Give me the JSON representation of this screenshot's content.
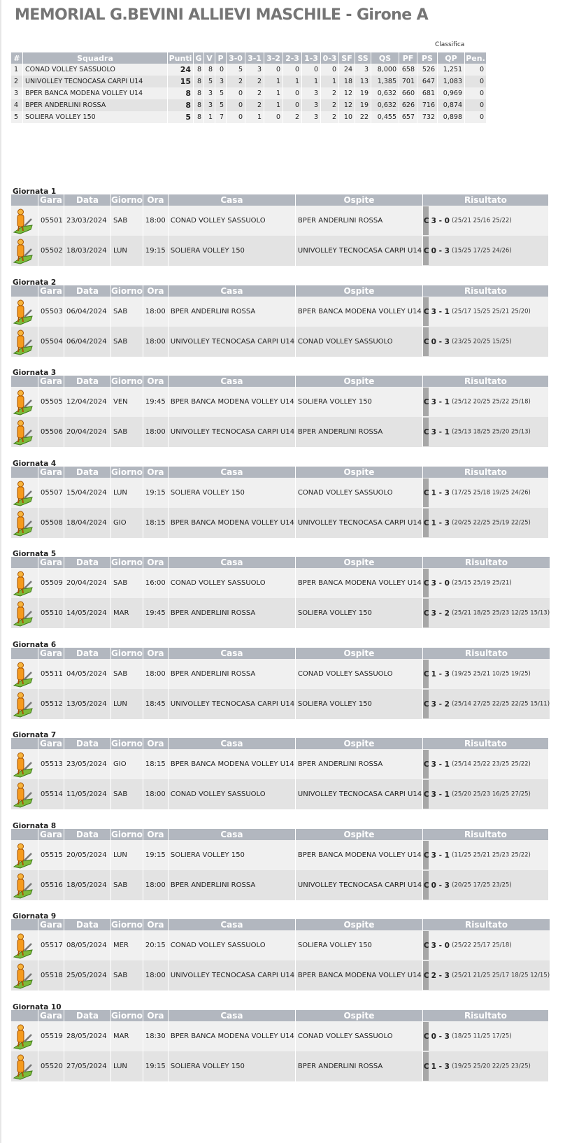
{
  "title": "MEMORIAL G.BEVINI ALLIEVI MASCHILE - Girone A",
  "standings": {
    "caption": "Classifica",
    "headers": [
      "#",
      "Squadra",
      "Punti",
      "G",
      "V",
      "P",
      "3-0",
      "3-1",
      "3-2",
      "2-3",
      "1-3",
      "0-3",
      "SF",
      "SS",
      "QS",
      "PF",
      "PS",
      "QP",
      "Pen."
    ],
    "rows": [
      [
        "1",
        "CONAD VOLLEY SASSUOLO",
        "24",
        "8",
        "8",
        "0",
        "5",
        "3",
        "0",
        "0",
        "0",
        "0",
        "24",
        "3",
        "8,000",
        "658",
        "526",
        "1,251",
        "0"
      ],
      [
        "2",
        "UNIVOLLEY TECNOCASA CARPI U14",
        "15",
        "8",
        "5",
        "3",
        "2",
        "2",
        "1",
        "1",
        "1",
        "1",
        "18",
        "13",
        "1,385",
        "701",
        "647",
        "1,083",
        "0"
      ],
      [
        "3",
        "BPER BANCA MODENA VOLLEY U14",
        "8",
        "8",
        "3",
        "5",
        "0",
        "2",
        "1",
        "0",
        "3",
        "2",
        "12",
        "19",
        "0,632",
        "660",
        "681",
        "0,969",
        "0"
      ],
      [
        "4",
        "BPER ANDERLINI ROSSA",
        "8",
        "8",
        "3",
        "5",
        "0",
        "2",
        "1",
        "0",
        "3",
        "2",
        "12",
        "19",
        "0,632",
        "626",
        "716",
        "0,874",
        "0"
      ],
      [
        "5",
        "SOLIERA VOLLEY 150",
        "5",
        "8",
        "1",
        "7",
        "0",
        "1",
        "0",
        "2",
        "3",
        "2",
        "10",
        "22",
        "0,455",
        "657",
        "732",
        "0,898",
        "0"
      ]
    ]
  },
  "match_headers": [
    "Gara",
    "Data",
    "Giorno",
    "Ora",
    "Casa",
    "Ospite",
    "Risultato"
  ],
  "match_icon": "referee-figure-icon",
  "result_marker": "C",
  "rounds": [
    {
      "title": "Giornata 1",
      "matches": [
        {
          "code": "05501",
          "date": "23/03/2024",
          "day": "SAB",
          "time": "18:00",
          "home": "CONAD VOLLEY SASSUOLO",
          "away": "BPER ANDERLINI ROSSA",
          "score": "3 - 0",
          "sets": "(25/21 25/16 25/22)"
        },
        {
          "code": "05502",
          "date": "18/03/2024",
          "day": "LUN",
          "time": "19:15",
          "home": "SOLIERA VOLLEY 150",
          "away": "UNIVOLLEY TECNOCASA CARPI U14",
          "score": "0 - 3",
          "sets": "(15/25 17/25 24/26)"
        }
      ]
    },
    {
      "title": "Giornata 2",
      "matches": [
        {
          "code": "05503",
          "date": "06/04/2024",
          "day": "SAB",
          "time": "18:00",
          "home": "BPER ANDERLINI ROSSA",
          "away": "BPER BANCA MODENA VOLLEY U14",
          "score": "3 - 1",
          "sets": "(25/17 15/25 25/21 25/20)"
        },
        {
          "code": "05504",
          "date": "06/04/2024",
          "day": "SAB",
          "time": "18:00",
          "home": "UNIVOLLEY TECNOCASA CARPI U14",
          "away": "CONAD VOLLEY SASSUOLO",
          "score": "0 - 3",
          "sets": "(23/25 20/25 15/25)"
        }
      ]
    },
    {
      "title": "Giornata 3",
      "matches": [
        {
          "code": "05505",
          "date": "12/04/2024",
          "day": "VEN",
          "time": "19:45",
          "home": "BPER BANCA MODENA VOLLEY U14",
          "away": "SOLIERA VOLLEY 150",
          "score": "3 - 1",
          "sets": "(25/12 20/25 25/22 25/18)"
        },
        {
          "code": "05506",
          "date": "20/04/2024",
          "day": "SAB",
          "time": "18:00",
          "home": "UNIVOLLEY TECNOCASA CARPI U14",
          "away": "BPER ANDERLINI ROSSA",
          "score": "3 - 1",
          "sets": "(25/13 18/25 25/20 25/13)"
        }
      ]
    },
    {
      "title": "Giornata 4",
      "matches": [
        {
          "code": "05507",
          "date": "15/04/2024",
          "day": "LUN",
          "time": "19:15",
          "home": "SOLIERA VOLLEY 150",
          "away": "CONAD VOLLEY SASSUOLO",
          "score": "1 - 3",
          "sets": "(17/25 25/18 19/25 24/26)"
        },
        {
          "code": "05508",
          "date": "18/04/2024",
          "day": "GIO",
          "time": "18:15",
          "home": "BPER BANCA MODENA VOLLEY U14",
          "away": "UNIVOLLEY TECNOCASA CARPI U14",
          "score": "1 - 3",
          "sets": "(20/25 22/25 25/19 22/25)"
        }
      ]
    },
    {
      "title": "Giornata 5",
      "matches": [
        {
          "code": "05509",
          "date": "20/04/2024",
          "day": "SAB",
          "time": "16:00",
          "home": "CONAD VOLLEY SASSUOLO",
          "away": "BPER BANCA MODENA VOLLEY U14",
          "score": "3 - 0",
          "sets": "(25/15 25/19 25/21)"
        },
        {
          "code": "05510",
          "date": "14/05/2024",
          "day": "MAR",
          "time": "19:45",
          "home": "BPER ANDERLINI ROSSA",
          "away": "SOLIERA VOLLEY 150",
          "score": "3 - 2",
          "sets": "(25/21 18/25 25/23 12/25 15/13)"
        }
      ]
    },
    {
      "title": "Giornata 6",
      "matches": [
        {
          "code": "05511",
          "date": "04/05/2024",
          "day": "SAB",
          "time": "18:00",
          "home": "BPER ANDERLINI ROSSA",
          "away": "CONAD VOLLEY SASSUOLO",
          "score": "1 - 3",
          "sets": "(19/25 25/21 10/25 19/25)"
        },
        {
          "code": "05512",
          "date": "13/05/2024",
          "day": "LUN",
          "time": "18:45",
          "home": "UNIVOLLEY TECNOCASA CARPI U14",
          "away": "SOLIERA VOLLEY 150",
          "score": "3 - 2",
          "sets": "(25/14 27/25 22/25 22/25 15/11)"
        }
      ]
    },
    {
      "title": "Giornata 7",
      "matches": [
        {
          "code": "05513",
          "date": "23/05/2024",
          "day": "GIO",
          "time": "18:15",
          "home": "BPER BANCA MODENA VOLLEY U14",
          "away": "BPER ANDERLINI ROSSA",
          "score": "3 - 1",
          "sets": "(25/14 25/22 23/25 25/22)"
        },
        {
          "code": "05514",
          "date": "11/05/2024",
          "day": "SAB",
          "time": "18:00",
          "home": "CONAD VOLLEY SASSUOLO",
          "away": "UNIVOLLEY TECNOCASA CARPI U14",
          "score": "3 - 1",
          "sets": "(25/20 25/23 16/25 27/25)"
        }
      ]
    },
    {
      "title": "Giornata 8",
      "matches": [
        {
          "code": "05515",
          "date": "20/05/2024",
          "day": "LUN",
          "time": "19:15",
          "home": "SOLIERA VOLLEY 150",
          "away": "BPER BANCA MODENA VOLLEY U14",
          "score": "3 - 1",
          "sets": "(11/25 25/21 25/23 25/22)"
        },
        {
          "code": "05516",
          "date": "18/05/2024",
          "day": "SAB",
          "time": "18:00",
          "home": "BPER ANDERLINI ROSSA",
          "away": "UNIVOLLEY TECNOCASA CARPI U14",
          "score": "0 - 3",
          "sets": "(20/25 17/25 23/25)"
        }
      ]
    },
    {
      "title": "Giornata 9",
      "matches": [
        {
          "code": "05517",
          "date": "08/05/2024",
          "day": "MER",
          "time": "20:15",
          "home": "CONAD VOLLEY SASSUOLO",
          "away": "SOLIERA VOLLEY 150",
          "score": "3 - 0",
          "sets": "(25/22 25/17 25/18)"
        },
        {
          "code": "05518",
          "date": "25/05/2024",
          "day": "SAB",
          "time": "18:00",
          "home": "UNIVOLLEY TECNOCASA CARPI U14",
          "away": "BPER BANCA MODENA VOLLEY U14",
          "score": "2 - 3",
          "sets": "(25/21 21/25 25/17 18/25 12/15)"
        }
      ]
    },
    {
      "title": "Giornata 10",
      "matches": [
        {
          "code": "05519",
          "date": "28/05/2024",
          "day": "MAR",
          "time": "18:30",
          "home": "BPER BANCA MODENA VOLLEY U14",
          "away": "CONAD VOLLEY SASSUOLO",
          "score": "0 - 3",
          "sets": "(18/25 11/25 17/25)"
        },
        {
          "code": "05520",
          "date": "27/05/2024",
          "day": "LUN",
          "time": "19:15",
          "home": "SOLIERA VOLLEY 150",
          "away": "BPER ANDERLINI ROSSA",
          "score": "1 - 3",
          "sets": "(19/25 25/20 22/25 23/25)"
        }
      ]
    }
  ]
}
